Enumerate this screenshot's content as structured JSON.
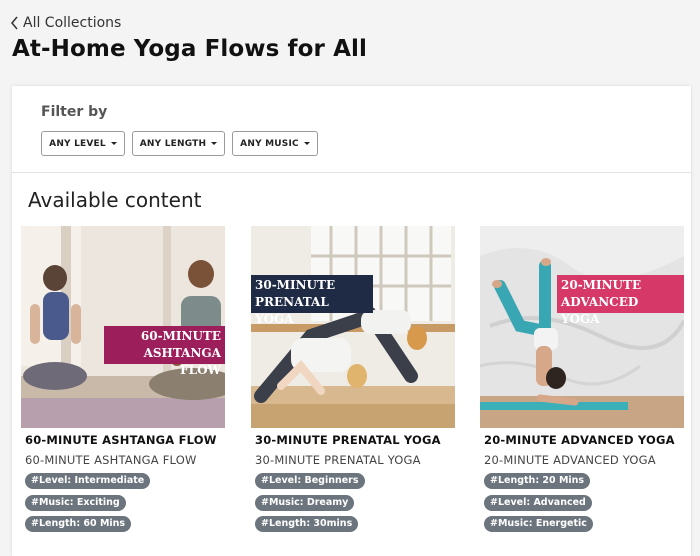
{
  "nav": {
    "back_label": "All Collections"
  },
  "page": {
    "title": "At-Home Yoga Flows for All"
  },
  "filters": {
    "label": "Filter by",
    "buttons": [
      "ANY LEVEL",
      "ANY LENGTH",
      "ANY MUSIC"
    ]
  },
  "content": {
    "heading": "Available content",
    "cards": [
      {
        "overlay_line1": "60-MINUTE",
        "overlay_line2": "ASHTANGA FLOW",
        "overlay_color": "#9c1f5c",
        "title": "60-MINUTE ASHTANGA FLOW",
        "subtitle": "60-MINUTE ASHTANGA FLOW",
        "tags": [
          "#Level: Intermediate",
          "#Music: Exciting",
          "#Length: 60 Mins"
        ]
      },
      {
        "overlay_line1": "30-MINUTE",
        "overlay_line2": "PRENATAL YOGA",
        "overlay_color": "#1f2a44",
        "title": "30-MINUTE PRENATAL YOGA",
        "subtitle": "30-MINUTE PRENATAL YOGA",
        "tags": [
          "#Level: Beginners",
          "#Music: Dreamy",
          "#Length: 30mins"
        ]
      },
      {
        "overlay_line1": "20-MINUTE",
        "overlay_line2": "ADVANCED YOGA",
        "overlay_color": "#d63868",
        "title": "20-MINUTE ADVANCED YOGA",
        "subtitle": "20-MINUTE ADVANCED YOGA",
        "tags": [
          "#Length: 20 Mins",
          "#Level: Advanced",
          "#Music: Energetic"
        ]
      }
    ]
  },
  "colors": {
    "tag_background": "#6c757d",
    "page_background": "#f4f4f4"
  }
}
